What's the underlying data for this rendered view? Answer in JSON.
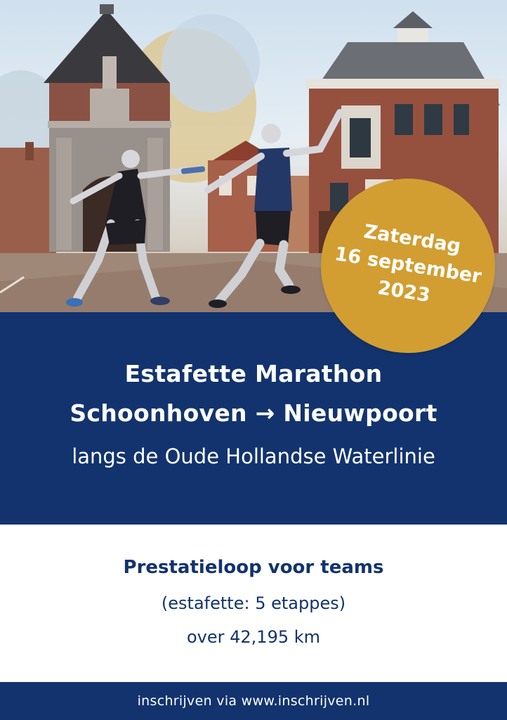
{
  "badge": {
    "line1": "Zaterdag",
    "line2": "16 september",
    "line3": "2023"
  },
  "title": {
    "line1": "Estafette Marathon",
    "line2": "Schoonhoven → Nieuwpoort",
    "subtitle": "langs de Oude Hollandse Waterlinie"
  },
  "info": {
    "heading": "Prestatieloop voor teams",
    "line1": "(estafette: 5 etappes)",
    "line2": "over 42,195 km"
  },
  "footer": {
    "text": "inschrijven via www.inschrijven.nl"
  },
  "colors": {
    "navy": "#12336e",
    "gold": "#d29e32"
  }
}
